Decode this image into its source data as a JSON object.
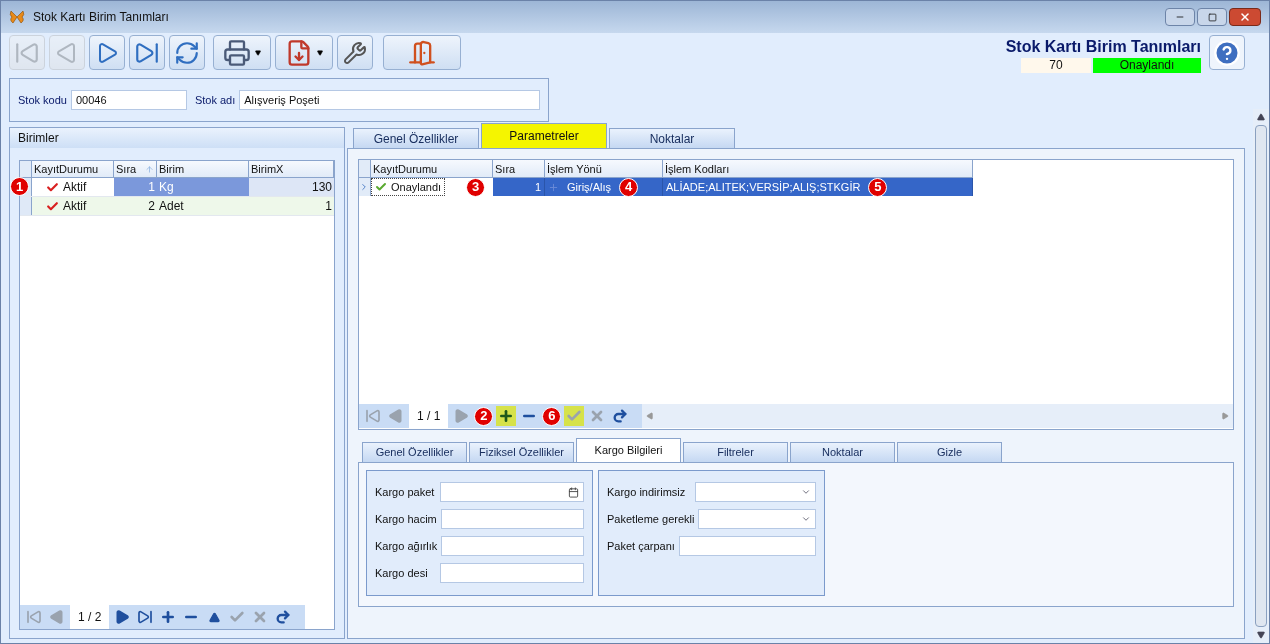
{
  "window": {
    "title": "Stok Kartı Birim Tanımları"
  },
  "toolbar": [
    {
      "kind": "first",
      "disabled": true
    },
    {
      "kind": "prev",
      "disabled": true
    },
    {
      "kind": "next",
      "disabled": false
    },
    {
      "kind": "last",
      "disabled": false
    },
    {
      "kind": "refresh",
      "disabled": false
    },
    {
      "kind": "print",
      "disabled": false
    },
    {
      "kind": "pdf",
      "disabled": false
    },
    {
      "kind": "tools",
      "disabled": false
    },
    {
      "kind": "exit",
      "disabled": false
    }
  ],
  "header": {
    "title": "Stok Kartı Birim Tanımları",
    "number": "70",
    "status": "Onaylandı"
  },
  "stock": {
    "code_label": "Stok kodu",
    "code": "00046",
    "name_label": "Stok adı",
    "name": "Alışveriş Poşeti"
  },
  "units": {
    "title": "Birimler",
    "columns": [
      "KayıtDurumu",
      "Sıra",
      "Birim",
      "BirimX"
    ],
    "callout": "1",
    "rows": [
      {
        "status": "Aktif",
        "order": "1",
        "unit": "Kg",
        "factor": "130",
        "selected": true
      },
      {
        "status": "Aktif",
        "order": "2",
        "unit": "Adet",
        "factor": "1",
        "selected": false
      }
    ],
    "pager": "1 / 2",
    "nav": [
      {
        "kind": "first",
        "disabled": true
      },
      {
        "kind": "prev",
        "disabled": true
      },
      {
        "kind": "pager"
      },
      {
        "kind": "next",
        "disabled": false
      },
      {
        "kind": "last",
        "disabled": false
      },
      {
        "kind": "add",
        "disabled": false
      },
      {
        "kind": "remove",
        "disabled": false
      },
      {
        "kind": "up",
        "disabled": false
      },
      {
        "kind": "post",
        "disabled": true
      },
      {
        "kind": "cancel",
        "disabled": true
      },
      {
        "kind": "refresh",
        "disabled": false
      }
    ]
  },
  "tabs": [
    {
      "label": "Genel Özellikler",
      "selected": false
    },
    {
      "label": "Parametreler",
      "selected": true
    },
    {
      "label": "Noktalar",
      "selected": false
    }
  ],
  "params": {
    "columns": [
      "KayıtDurumu",
      "Sıra",
      "İşlem Yönü",
      "İşlem Kodları"
    ],
    "rows": [
      {
        "selected": true,
        "cells": [
          {
            "text": "Onaylandı",
            "callout": "3"
          },
          {
            "text": "1"
          },
          {
            "text": "Giriş/Alış",
            "callout": "4"
          },
          {
            "text": "ALİADE;ALITEK;VERSİP;ALIŞ;STKGİR",
            "callout": "5"
          }
        ]
      }
    ],
    "pager": "1 / 1",
    "nav": [
      {
        "kind": "first",
        "disabled": true
      },
      {
        "kind": "prev",
        "disabled": true
      },
      {
        "kind": "pager"
      },
      {
        "kind": "next",
        "disabled": true
      },
      {
        "kind": "callout",
        "text": "2"
      },
      {
        "kind": "add",
        "disabled": false,
        "highlighted": true
      },
      {
        "kind": "remove",
        "disabled": false
      },
      {
        "kind": "callout",
        "text": "6"
      },
      {
        "kind": "post",
        "disabled": true,
        "highlighted": true
      },
      {
        "kind": "cancel",
        "disabled": true
      },
      {
        "kind": "refresh",
        "disabled": false
      }
    ]
  },
  "bottom_tabs": [
    {
      "label": "Genel Özellikler",
      "selected": false
    },
    {
      "label": "Fiziksel Özellikler",
      "selected": false
    },
    {
      "label": "Kargo Bilgileri",
      "selected": true
    },
    {
      "label": "Filtreler",
      "selected": false
    },
    {
      "label": "Noktalar",
      "selected": false
    },
    {
      "label": "Gizle",
      "selected": false
    }
  ],
  "cargo": {
    "left": [
      {
        "label": "Kargo paket",
        "kind": "picker"
      },
      {
        "label": "Kargo hacim",
        "kind": "text"
      },
      {
        "label": "Kargo ağırlık",
        "kind": "text"
      },
      {
        "label": "Kargo desi",
        "kind": "text"
      }
    ],
    "right": [
      {
        "label": "Kargo indirimsiz",
        "kind": "dropdown"
      },
      {
        "label": "Paketleme gerekli",
        "kind": "dropdown"
      },
      {
        "label": "Paket çarpanı",
        "kind": "text"
      }
    ]
  }
}
